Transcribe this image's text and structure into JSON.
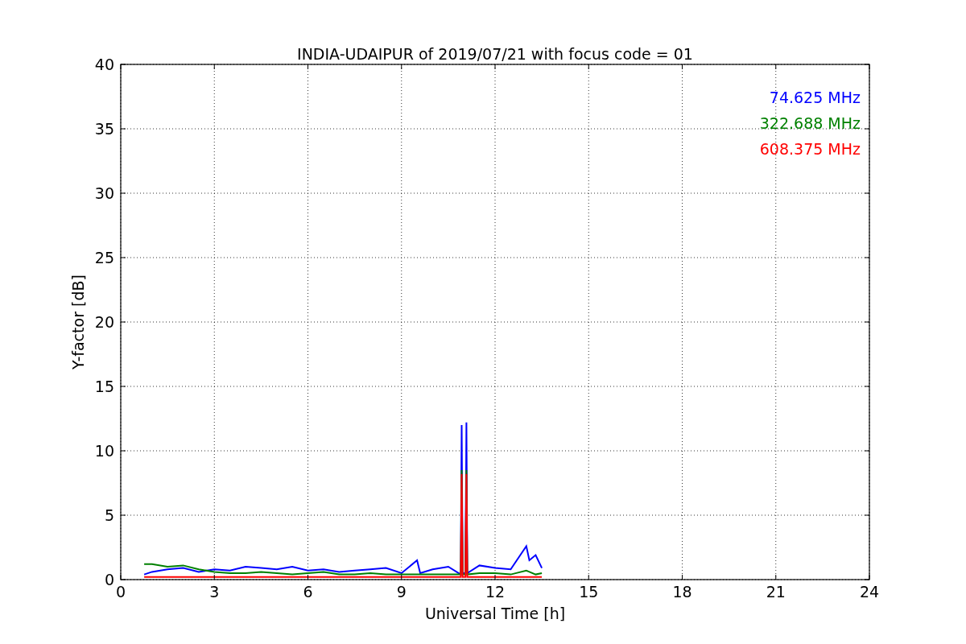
{
  "chart_data": {
    "type": "line",
    "title": "INDIA-UDAIPUR of 2019/07/21 with focus code = 01",
    "xlabel": "Universal Time [h]",
    "ylabel": "Y-factor [dB]",
    "x": [
      0.75,
      1,
      1.5,
      2,
      2.5,
      3,
      3.5,
      4,
      4.5,
      5,
      5.5,
      6,
      6.5,
      7,
      7.5,
      8,
      8.5,
      9,
      9.5,
      9.6,
      10,
      10.5,
      10.9,
      10.93,
      10.96,
      11.05,
      11.08,
      11.11,
      11.5,
      12,
      12.5,
      13,
      13.1,
      13.3,
      13.5
    ],
    "series": [
      {
        "name": "74.625 MHz",
        "color": "#0000ff",
        "values": [
          0.4,
          0.6,
          0.8,
          0.9,
          0.6,
          0.8,
          0.7,
          1.0,
          0.9,
          0.8,
          1.0,
          0.7,
          0.8,
          0.6,
          0.7,
          0.8,
          0.9,
          0.5,
          1.5,
          0.5,
          0.8,
          1.0,
          0.4,
          12.0,
          0.5,
          0.5,
          12.2,
          0.5,
          1.1,
          0.9,
          0.8,
          2.6,
          1.5,
          1.9,
          0.9
        ]
      },
      {
        "name": "322.688 MHz",
        "color": "#008000",
        "values": [
          1.2,
          1.2,
          1.0,
          1.1,
          0.8,
          0.6,
          0.5,
          0.5,
          0.6,
          0.5,
          0.4,
          0.5,
          0.6,
          0.4,
          0.4,
          0.5,
          0.4,
          0.4,
          0.4,
          0.4,
          0.4,
          0.4,
          0.4,
          8.5,
          0.4,
          0.4,
          8.5,
          0.4,
          0.5,
          0.5,
          0.4,
          0.7,
          0.6,
          0.4,
          0.5
        ]
      },
      {
        "name": "608.375 MHz",
        "color": "#ff0000",
        "values": [
          0.2,
          0.2,
          0.2,
          0.2,
          0.2,
          0.2,
          0.2,
          0.2,
          0.2,
          0.2,
          0.2,
          0.2,
          0.2,
          0.2,
          0.2,
          0.2,
          0.2,
          0.2,
          0.2,
          0.2,
          0.2,
          0.2,
          0.2,
          8.2,
          0.2,
          0.2,
          8.2,
          0.2,
          0.2,
          0.2,
          0.2,
          0.2,
          0.2,
          0.2,
          0.2
        ]
      }
    ],
    "xlim": [
      0,
      24
    ],
    "ylim": [
      0,
      40
    ],
    "xticks": [
      0,
      3,
      6,
      9,
      12,
      15,
      18,
      21,
      24
    ],
    "yticks": [
      0,
      5,
      10,
      15,
      20,
      25,
      30,
      35,
      40
    ],
    "grid": true
  }
}
